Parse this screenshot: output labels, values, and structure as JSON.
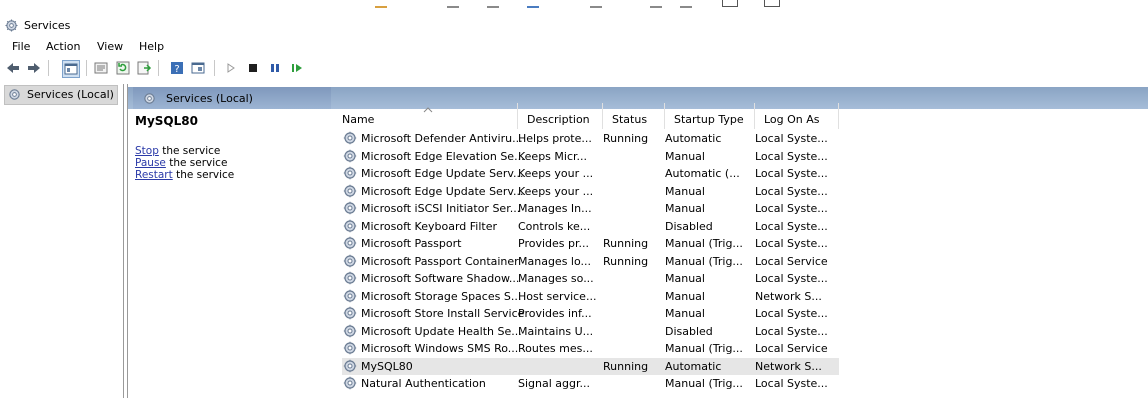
{
  "window": {
    "title": "Services"
  },
  "menu": [
    "File",
    "Action",
    "View",
    "Help"
  ],
  "tree": {
    "root_label": "Services (Local)"
  },
  "main_header": {
    "label": "Services (Local)"
  },
  "description_panel": {
    "service_name": "MySQL80",
    "actions": [
      {
        "link": "Stop",
        "rest": " the service"
      },
      {
        "link": "Pause",
        "rest": " the service"
      },
      {
        "link": "Restart",
        "rest": " the service"
      }
    ]
  },
  "table": {
    "columns": [
      "Name",
      "Description",
      "Status",
      "Startup Type",
      "Log On As"
    ],
    "rows": [
      {
        "name": "Microsoft Defender Antiviru...",
        "description": "Helps prote...",
        "status": "Running",
        "startup": "Automatic",
        "logon": "Local Syste..."
      },
      {
        "name": "Microsoft Edge Elevation Se...",
        "description": "Keeps Micr...",
        "status": "",
        "startup": "Manual",
        "logon": "Local Syste..."
      },
      {
        "name": "Microsoft Edge Update Serv...",
        "description": "Keeps your ...",
        "status": "",
        "startup": "Automatic (...",
        "logon": "Local Syste..."
      },
      {
        "name": "Microsoft Edge Update Serv...",
        "description": "Keeps your ...",
        "status": "",
        "startup": "Manual",
        "logon": "Local Syste..."
      },
      {
        "name": "Microsoft iSCSI Initiator Ser...",
        "description": "Manages In...",
        "status": "",
        "startup": "Manual",
        "logon": "Local Syste..."
      },
      {
        "name": "Microsoft Keyboard Filter",
        "description": "Controls ke...",
        "status": "",
        "startup": "Disabled",
        "logon": "Local Syste..."
      },
      {
        "name": "Microsoft Passport",
        "description": "Provides pr...",
        "status": "Running",
        "startup": "Manual (Trig...",
        "logon": "Local Syste..."
      },
      {
        "name": "Microsoft Passport Container",
        "description": "Manages lo...",
        "status": "Running",
        "startup": "Manual (Trig...",
        "logon": "Local Service"
      },
      {
        "name": "Microsoft Software Shadow...",
        "description": "Manages so...",
        "status": "",
        "startup": "Manual",
        "logon": "Local Syste..."
      },
      {
        "name": "Microsoft Storage Spaces S...",
        "description": "Host service...",
        "status": "",
        "startup": "Manual",
        "logon": "Network S..."
      },
      {
        "name": "Microsoft Store Install Service",
        "description": "Provides inf...",
        "status": "",
        "startup": "Manual",
        "logon": "Local Syste..."
      },
      {
        "name": "Microsoft Update Health Se...",
        "description": "Maintains U...",
        "status": "",
        "startup": "Disabled",
        "logon": "Local Syste..."
      },
      {
        "name": "Microsoft Windows SMS Ro...",
        "description": "Routes mes...",
        "status": "",
        "startup": "Manual (Trig...",
        "logon": "Local Service"
      },
      {
        "name": "MySQL80",
        "description": "",
        "status": "Running",
        "startup": "Automatic",
        "logon": "Network S...",
        "selected": true
      },
      {
        "name": "Natural Authentication",
        "description": "Signal aggr...",
        "status": "",
        "startup": "Manual (Trig...",
        "logon": "Local Syste..."
      }
    ]
  },
  "icons": {
    "title": "gear-services-icon",
    "toolbar": [
      "back-arrow-icon",
      "forward-arrow-icon",
      "show-hide-console-tree-icon",
      "properties-icon",
      "refresh-icon",
      "export-list-icon",
      "help-icon",
      "console-icon",
      "start-service-icon",
      "stop-service-icon",
      "pause-service-icon",
      "resume-service-icon"
    ]
  },
  "colors": {
    "header_band": "#9cb4d3",
    "link": "#2b3aa8",
    "selected_row": "#e6e6e6",
    "play_green": "#2e9e3c"
  }
}
